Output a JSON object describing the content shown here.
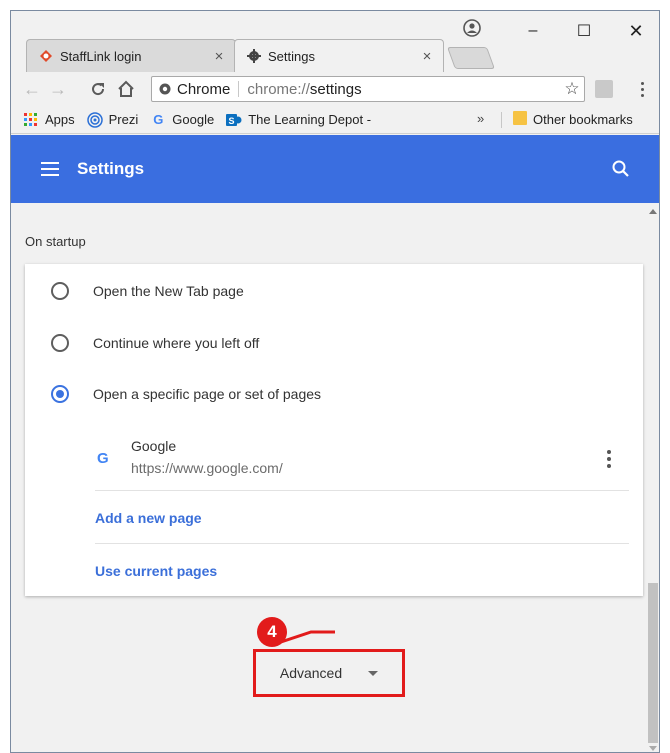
{
  "tabs": [
    {
      "title": "StaffLink login",
      "close": "×",
      "icon": "stafflink-icon",
      "active": false
    },
    {
      "title": "Settings",
      "close": "×",
      "icon": "gear-icon",
      "active": true
    }
  ],
  "window_controls": {
    "minimize": "–",
    "maximize": "☐",
    "close": "✕"
  },
  "toolbar": {
    "back": "←",
    "forward": "→",
    "reload": "C",
    "home": "⌂",
    "omnibox_label": "Chrome",
    "omnibox_url_scheme": "chrome://",
    "omnibox_url_path": "settings",
    "star": "☆"
  },
  "bookmarks": {
    "items": [
      {
        "label": "Apps",
        "icon": "apps-grid-icon"
      },
      {
        "label": "Prezi",
        "icon": "prezi-icon"
      },
      {
        "label": "Google",
        "icon": "google-icon"
      },
      {
        "label": "The Learning Depot -",
        "icon": "sharepoint-icon"
      }
    ],
    "more": "»",
    "other": "Other bookmarks"
  },
  "header": {
    "title": "Settings"
  },
  "startup": {
    "section_title": "On startup",
    "options": [
      {
        "label": "Open the New Tab page",
        "checked": false
      },
      {
        "label": "Continue where you left off",
        "checked": false
      },
      {
        "label": "Open a specific page or set of pages",
        "checked": true
      }
    ],
    "page": {
      "name": "Google",
      "url": "https://www.google.com/",
      "logo": "G"
    },
    "add_page": "Add a new page",
    "use_current": "Use current pages"
  },
  "advanced": {
    "label": "Advanced"
  },
  "annotation": {
    "step": "4"
  },
  "colors": {
    "header_blue": "#3a6ee0",
    "accent_blue": "#3b73e0",
    "annotation_red": "#e21b1b"
  }
}
